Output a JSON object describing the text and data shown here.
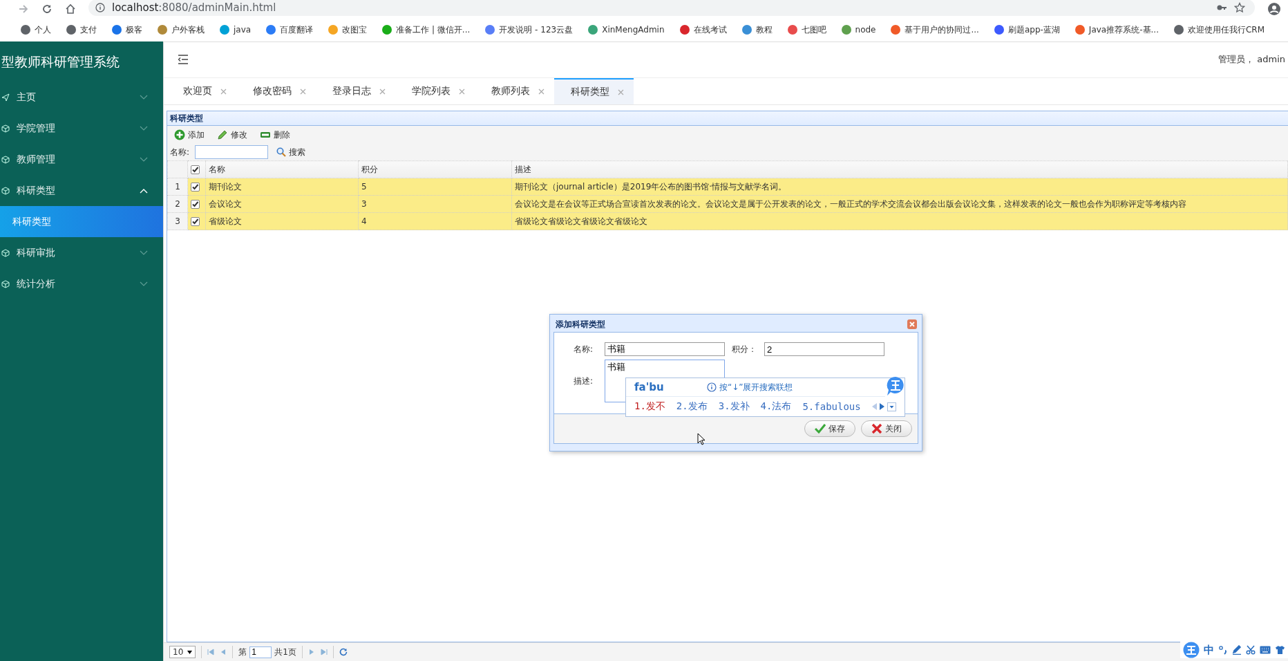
{
  "browser": {
    "url_host": "localhost",
    "url_path": ":8080/adminMain.html",
    "bookmarks": [
      {
        "label": "个人",
        "color": "#5f6368"
      },
      {
        "label": "支付",
        "color": "#5f6368"
      },
      {
        "label": "极客",
        "color": "#1a73e8"
      },
      {
        "label": "户外客栈",
        "color": "#b08a3a"
      },
      {
        "label": "java",
        "color": "#00a1d6"
      },
      {
        "label": "百度翻译",
        "color": "#2b7cf6"
      },
      {
        "label": "改图宝",
        "color": "#f5a623"
      },
      {
        "label": "准备工作 | 微信开...",
        "color": "#1aad19"
      },
      {
        "label": "开发说明 - 123云盘",
        "color": "#597ef7"
      },
      {
        "label": "XinMengAdmin",
        "color": "#3aa57a"
      },
      {
        "label": "在线考试",
        "color": "#d9262c"
      },
      {
        "label": "教程",
        "color": "#3a8fd6"
      },
      {
        "label": "七图吧",
        "color": "#e84c4c"
      },
      {
        "label": "node",
        "color": "#5fa04e"
      },
      {
        "label": "基于用户的协同过...",
        "color": "#f05a28"
      },
      {
        "label": "刷题app-蓝湖",
        "color": "#3d5afe"
      },
      {
        "label": "Java推荐系统-基...",
        "color": "#f05a28"
      },
      {
        "label": "欢迎使用任我行CRM",
        "color": "#5f6368"
      }
    ]
  },
  "sidebar": {
    "title": "型教师科研管理系统",
    "items": [
      {
        "label": "主页",
        "expanded": false,
        "selected": false
      },
      {
        "label": "学院管理",
        "expanded": false,
        "selected": false
      },
      {
        "label": "教师管理",
        "expanded": false,
        "selected": false
      },
      {
        "label": "科研类型",
        "expanded": true,
        "selected": false,
        "children": [
          {
            "label": "科研类型",
            "selected": true
          }
        ]
      },
      {
        "label": "科研审批",
        "expanded": false,
        "selected": false
      },
      {
        "label": "统计分析",
        "expanded": false,
        "selected": false
      }
    ]
  },
  "header": {
    "user": "管理员， admin"
  },
  "tabs": [
    {
      "label": "欢迎页",
      "selected": false
    },
    {
      "label": "修改密码",
      "selected": false
    },
    {
      "label": "登录日志",
      "selected": false
    },
    {
      "label": "学院列表",
      "selected": false
    },
    {
      "label": "教师列表",
      "selected": false
    },
    {
      "label": "科研类型",
      "selected": true
    }
  ],
  "panel": {
    "title": "科研类型",
    "toolbar": [
      {
        "label": "添加",
        "kind": "add"
      },
      {
        "label": "修改",
        "kind": "edit"
      },
      {
        "label": "删除",
        "kind": "remove"
      }
    ],
    "search": {
      "label": "名称:",
      "button": "搜索"
    }
  },
  "table": {
    "all_checked": true,
    "columns": [
      "名称",
      "积分",
      "描述"
    ],
    "rows": [
      {
        "number": "1",
        "checked": true,
        "cells": [
          "期刊论文",
          "5",
          "期刊论文（journal article）是2019年公布的图书馆·情报与文献学名词。"
        ]
      },
      {
        "number": "2",
        "checked": true,
        "cells": [
          "会议论文",
          "3",
          "会议论文是在会议等正式场合宣读首次发表的论文。会议论文是属于公开发表的论文，一般正式的学术交流会议都会出版会议论文集，这样发表的论文一般也会作为职称评定等考核内容"
        ]
      },
      {
        "number": "3",
        "checked": true,
        "cells": [
          "省级论文",
          "4",
          "省级论文省级论文省级论文省级论文"
        ]
      }
    ]
  },
  "pager": {
    "page_size": "10",
    "page_prefix": "第",
    "page": "1",
    "page_total": "共1页"
  },
  "dialog": {
    "title": "添加科研类型",
    "name_label": "名称:",
    "name_value": "书籍",
    "score_label": "积分：",
    "score_value": "2",
    "desc_label": "描述:",
    "desc_value": "书籍",
    "buttons": [
      {
        "label": "保存",
        "kind": "save"
      },
      {
        "label": "关闭",
        "kind": "close"
      }
    ]
  },
  "ime": {
    "composition": "fa'bu",
    "hint": "按“↓”展开搜索联想",
    "candidates": [
      {
        "label": "1.发不",
        "selected": true
      },
      {
        "label": "2.发布",
        "selected": false
      },
      {
        "label": "3.发补",
        "selected": false
      },
      {
        "label": "4.法布",
        "selected": false
      },
      {
        "label": "5.fabulous",
        "selected": false
      }
    ],
    "toolbar_label": "中"
  }
}
